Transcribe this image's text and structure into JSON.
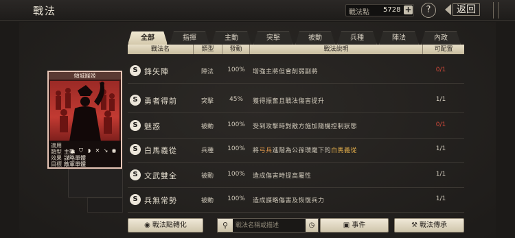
{
  "header": {
    "title": "戰法",
    "points_label": "戰法點",
    "points_value": "5728",
    "plus": "+",
    "help": "?",
    "back_label": "返回"
  },
  "tabs": [
    {
      "label": "全部",
      "active": true
    },
    {
      "label": "指揮",
      "active": false
    },
    {
      "label": "主動",
      "active": false
    },
    {
      "label": "突擊",
      "active": false
    },
    {
      "label": "被動",
      "active": false
    },
    {
      "label": "兵種",
      "active": false
    },
    {
      "label": "陣法",
      "active": false
    },
    {
      "label": "內政",
      "active": false
    }
  ],
  "columns": {
    "name": "戰法名",
    "type": "類型",
    "rate": "發動",
    "desc": "戰法說明",
    "config": "可配置"
  },
  "rows": [
    {
      "badge": "S",
      "name": "鋒矢陣",
      "type": "陣法",
      "rate": "100%",
      "desc": "增強主將但會削弱副將",
      "config": "0/1",
      "config_red": true
    },
    {
      "badge": "S",
      "name": "勇者得前",
      "type": "突擊",
      "rate": "45%",
      "desc": "獲得振奮且戰法傷害提升",
      "config": "1/1",
      "config_red": false
    },
    {
      "badge": "S",
      "name": "魅惑",
      "type": "被動",
      "rate": "100%",
      "desc": "受到攻擊時對敵方施加隨機控制狀態",
      "config": "0/1",
      "config_red": true
    },
    {
      "badge": "S",
      "name": "白馬義從",
      "type": "兵種",
      "rate": "100%",
      "desc_pre": "將",
      "desc_hl1": "弓兵",
      "desc_mid": "進階為公孫瓚麾下的",
      "desc_hl2": "白馬義從",
      "config": "1/1",
      "config_red": false
    },
    {
      "badge": "S",
      "name": "文武雙全",
      "type": "被動",
      "rate": "100%",
      "desc": "造成傷害時提高屬性",
      "config": "1/1",
      "config_red": false
    },
    {
      "badge": "S",
      "name": "兵無常勢",
      "type": "被動",
      "rate": "100%",
      "desc": "造成謀略傷害及恢復兵力",
      "config": "1/1",
      "config_red": false
    }
  ],
  "card": {
    "title": "傾城寵姬",
    "lines": [
      {
        "k": "適用",
        "v": ""
      },
      {
        "k": "類型",
        "v": "主動"
      },
      {
        "k": "效果",
        "v": "謀略單體"
      },
      {
        "k": "目標",
        "v": "敵軍單體"
      }
    ]
  },
  "bottom": {
    "convert_label": "戰法點轉化",
    "search_placeholder": "戰法名稱或描述",
    "event_label": "事件",
    "inherit_label": "戰法傳承"
  }
}
